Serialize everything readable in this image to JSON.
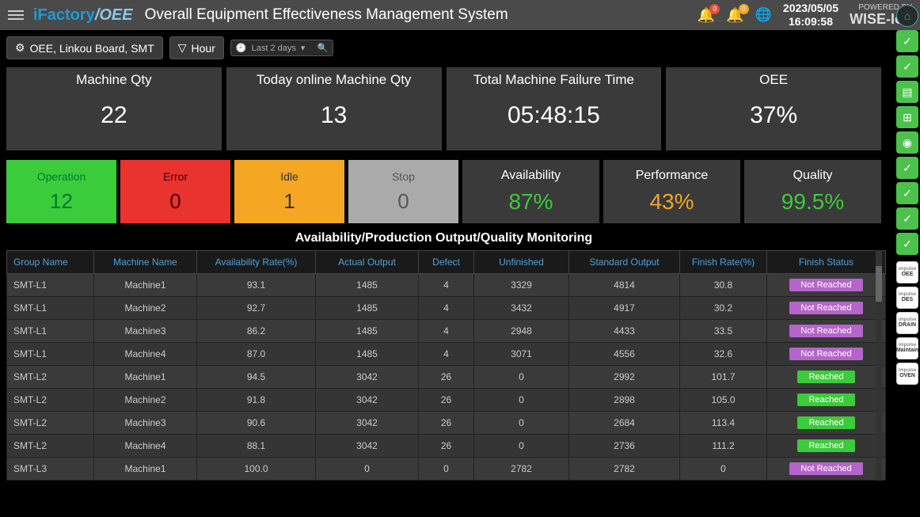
{
  "header": {
    "logo1": "iFactory",
    "logo2": "/OEE",
    "title": "Overall Equipment Effectiveness Management System",
    "bell1_badge": "0",
    "bell2_badge": "0",
    "date": "2023/05/05",
    "time": "16:09:58",
    "powered_top": "POWERED BY",
    "powered_bottom": "WISE-IoT"
  },
  "toolbar": {
    "breadcrumb": "OEE, Linkou Board, SMT",
    "filter": "Hour",
    "range": "Last 2 days"
  },
  "cards": {
    "c1_label": "Machine Qty",
    "c1_value": "22",
    "c2_label": "Today online Machine Qty",
    "c2_value": "13",
    "c3_label": "Total Machine Failure Time",
    "c3_value": "05:48:15",
    "c4_label": "OEE",
    "c4_value": "37%"
  },
  "status": {
    "op_label": "Operation",
    "op_value": "12",
    "er_label": "Error",
    "er_value": "0",
    "id_label": "Idle",
    "id_value": "1",
    "st_label": "Stop",
    "st_value": "0",
    "av_label": "Availability",
    "av_value": "87%",
    "pf_label": "Performance",
    "pf_value": "43%",
    "ql_label": "Quality",
    "ql_value": "99.5%"
  },
  "section_title": "Availability/Production Output/Quality Monitoring",
  "columns": {
    "c0": "Group Name",
    "c1": "Machine Name",
    "c2": "Availability Rate(%)",
    "c3": "Actual Output",
    "c4": "Defect",
    "c5": "Unfinished",
    "c6": "Standard Output",
    "c7": "Finish Rate(%)",
    "c8": "Finish Status"
  },
  "status_labels": {
    "reached": "Reached",
    "not_reached": "Not Reached"
  },
  "rows": [
    {
      "g": "SMT-L1",
      "m": "Machine1",
      "a": "93.1",
      "o": "1485",
      "d": "4",
      "u": "3329",
      "s": "4814",
      "f": "30.8",
      "st": "nr"
    },
    {
      "g": "SMT-L1",
      "m": "Machine2",
      "a": "92.7",
      "o": "1485",
      "d": "4",
      "u": "3432",
      "s": "4917",
      "f": "30.2",
      "st": "nr"
    },
    {
      "g": "SMT-L1",
      "m": "Machine3",
      "a": "86.2",
      "o": "1485",
      "d": "4",
      "u": "2948",
      "s": "4433",
      "f": "33.5",
      "st": "nr"
    },
    {
      "g": "SMT-L1",
      "m": "Machine4",
      "a": "87.0",
      "o": "1485",
      "d": "4",
      "u": "3071",
      "s": "4556",
      "f": "32.6",
      "st": "nr"
    },
    {
      "g": "SMT-L2",
      "m": "Machine1",
      "a": "94.5",
      "o": "3042",
      "d": "26",
      "u": "0",
      "s": "2992",
      "f": "101.7",
      "st": "r"
    },
    {
      "g": "SMT-L2",
      "m": "Machine2",
      "a": "91.8",
      "o": "3042",
      "d": "26",
      "u": "0",
      "s": "2898",
      "f": "105.0",
      "st": "r"
    },
    {
      "g": "SMT-L2",
      "m": "Machine3",
      "a": "90.6",
      "o": "3042",
      "d": "26",
      "u": "0",
      "s": "2684",
      "f": "113.4",
      "st": "r"
    },
    {
      "g": "SMT-L2",
      "m": "Machine4",
      "a": "88.1",
      "o": "3042",
      "d": "26",
      "u": "0",
      "s": "2736",
      "f": "111.2",
      "st": "r"
    },
    {
      "g": "SMT-L3",
      "m": "Machine1",
      "a": "100.0",
      "o": "0",
      "d": "0",
      "u": "2782",
      "s": "2782",
      "f": "0",
      "st": "nr"
    }
  ],
  "dock": {
    "white": [
      {
        "t": "impulse",
        "b": "OEE"
      },
      {
        "t": "impulse",
        "b": "DES"
      },
      {
        "t": "impulse",
        "b": "DRAIN"
      },
      {
        "t": "impulse",
        "b": "Maintain"
      },
      {
        "t": "impulse",
        "b": "OVEN"
      }
    ]
  }
}
